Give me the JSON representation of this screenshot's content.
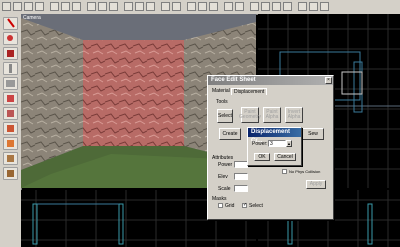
{
  "viewport_3d": {
    "label": "Camera"
  },
  "face_edit_sheet": {
    "title": "Face Edit Sheet",
    "tabs": [
      "Material",
      "Displacement"
    ],
    "tools_group": "Tools",
    "select_button": "Select",
    "paint_geometry": "Paint Geometry",
    "paint_alpha": "Paint Alpha",
    "invert_alpha": "Invert Alpha",
    "create_button": "Create",
    "sew_button": "Sew",
    "attributes_group": "Attributes",
    "power_label": "Power",
    "elevation_label": "Elev",
    "scale_label": "Scale",
    "apply_button": "Apply",
    "noisy_label": "No Phys Collision",
    "masks_group": "Masks",
    "grid_label": "Grid",
    "select_mask_label": "Select",
    "select_mask_checked": true,
    "grid_checked": false
  },
  "create_dialog": {
    "title": "Displacement Cr...",
    "power_label": "Power:",
    "power_value": "3",
    "ok_label": "OK",
    "cancel_label": "Cancel"
  }
}
